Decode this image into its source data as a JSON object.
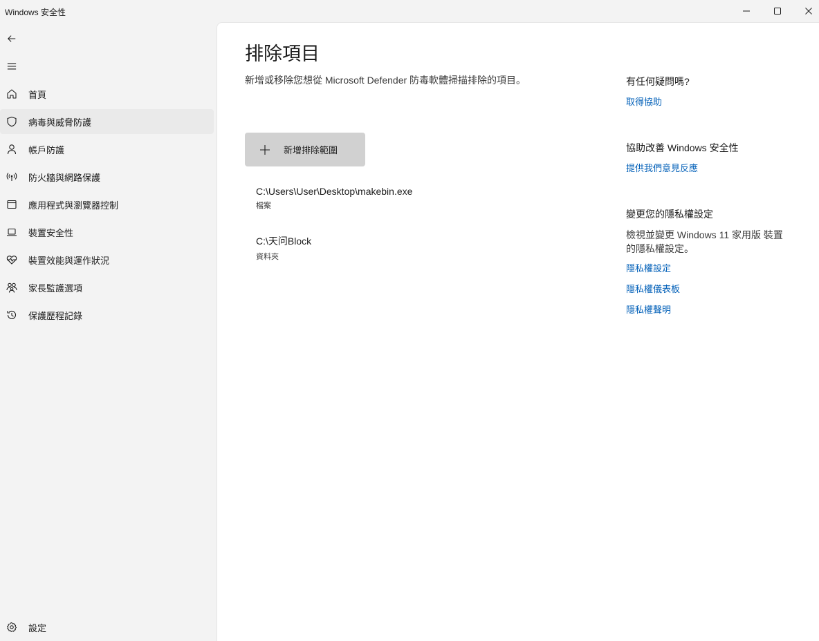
{
  "window": {
    "title": "Windows 安全性"
  },
  "sidebar": {
    "items": [
      {
        "label": "首頁",
        "icon": "home-icon"
      },
      {
        "label": "病毒與威脅防護",
        "icon": "shield-icon",
        "active": true
      },
      {
        "label": "帳戶防護",
        "icon": "person-icon"
      },
      {
        "label": "防火牆與網路保護",
        "icon": "antenna-icon"
      },
      {
        "label": "應用程式與瀏覽器控制",
        "icon": "app-window-icon"
      },
      {
        "label": "裝置安全性",
        "icon": "laptop-icon"
      },
      {
        "label": "裝置效能與運作狀況",
        "icon": "heart-pulse-icon"
      },
      {
        "label": "家長監護選項",
        "icon": "family-icon"
      },
      {
        "label": "保護歷程記錄",
        "icon": "history-icon"
      }
    ],
    "settings_label": "設定"
  },
  "main": {
    "title": "排除項目",
    "description": "新增或移除您想從 Microsoft Defender 防毒軟體掃描排除的項目。",
    "add_button_label": "新增排除範圍",
    "exclusions": [
      {
        "path": "C:\\Users\\User\\Desktop\\makebin.exe",
        "type": "檔案"
      },
      {
        "path": "C:\\天问Block",
        "type": "資料夾"
      }
    ]
  },
  "right_panel": {
    "help": {
      "heading": "有任何疑問嗎?",
      "link": "取得協助"
    },
    "improve": {
      "heading": "協助改善 Windows 安全性",
      "link": "提供我們意見反應"
    },
    "privacy": {
      "heading": "變更您的隱私權設定",
      "text": "檢視並變更 Windows 11 家用版 裝置的隱私權設定。",
      "links": [
        "隱私權設定",
        "隱私權儀表板",
        "隱私權聲明"
      ]
    }
  },
  "colors": {
    "link": "#005fb8",
    "button_bg": "#d1d1d1",
    "sidebar_bg": "#f3f3f3",
    "active_item_bg": "#eaeaea"
  }
}
